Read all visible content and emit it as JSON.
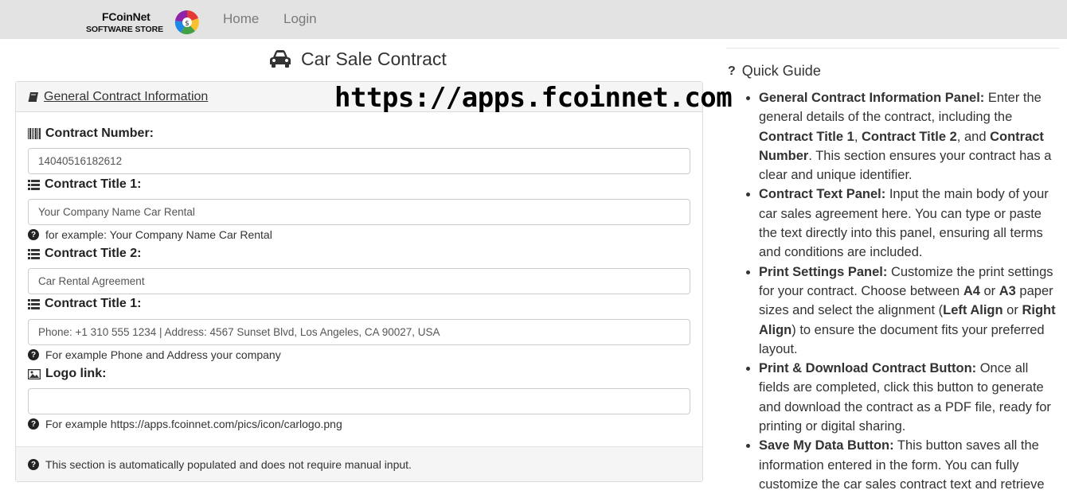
{
  "nav": {
    "brand_line1": "FCoinNet",
    "brand_line2": "SOFTWARE STORE",
    "links": [
      "Home",
      "Login"
    ]
  },
  "page": {
    "title": "Car Sale Contract"
  },
  "card": {
    "header_title": "General Contract Information",
    "watermark": "https://apps.fcoinnet.com",
    "fields": {
      "contract_number": {
        "label": "Contract Number:",
        "value": "14040516182612"
      },
      "title1": {
        "label": "Contract Title 1:",
        "value": "Your Company Name Car Rental",
        "help": "for example: Your Company Name Car Rental"
      },
      "title2": {
        "label": "Contract Title 2:",
        "value": "Car Rental Agreement"
      },
      "title3": {
        "label": "Contract Title 1:",
        "value": "Phone: +1 310 555 1234 | Address: 4567 Sunset Blvd, Los Angeles, CA 90027, USA",
        "help": "For example Phone and Address your company"
      },
      "logo": {
        "label": "Logo link:",
        "value": "",
        "help": "For example https://apps.fcoinnet.com/pics/icon/carlogo.png"
      }
    },
    "footer_note": "This section is automatically populated and does not require manual input."
  },
  "guide": {
    "title": "Quick Guide",
    "items": [
      {
        "segments": [
          {
            "b": true,
            "t": "General Contract Information Panel:"
          },
          {
            "b": false,
            "t": " Enter the general details of the contract, including the "
          },
          {
            "b": true,
            "t": "Contract Title 1"
          },
          {
            "b": false,
            "t": ", "
          },
          {
            "b": true,
            "t": "Contract Title 2"
          },
          {
            "b": false,
            "t": ", and "
          },
          {
            "b": true,
            "t": "Contract Number"
          },
          {
            "b": false,
            "t": ". This section ensures your contract has a clear and unique identifier."
          }
        ]
      },
      {
        "segments": [
          {
            "b": true,
            "t": "Contract Text Panel:"
          },
          {
            "b": false,
            "t": " Input the main body of your car sales agreement here. You can type or paste the text directly into this panel, ensuring all terms and conditions are included."
          }
        ]
      },
      {
        "segments": [
          {
            "b": true,
            "t": "Print Settings Panel:"
          },
          {
            "b": false,
            "t": " Customize the print settings for your contract. Choose between "
          },
          {
            "b": true,
            "t": "A4"
          },
          {
            "b": false,
            "t": " or "
          },
          {
            "b": true,
            "t": "A3"
          },
          {
            "b": false,
            "t": " paper sizes and select the alignment ("
          },
          {
            "b": true,
            "t": "Left Align"
          },
          {
            "b": false,
            "t": " or "
          },
          {
            "b": true,
            "t": "Right Align"
          },
          {
            "b": false,
            "t": ") to ensure the document fits your preferred layout."
          }
        ]
      },
      {
        "segments": [
          {
            "b": true,
            "t": "Print & Download Contract Button:"
          },
          {
            "b": false,
            "t": " Once all fields are completed, click this button to generate and download the contract as a PDF file, ready for printing or digital sharing."
          }
        ]
      },
      {
        "segments": [
          {
            "b": true,
            "t": "Save My Data Button:"
          },
          {
            "b": false,
            "t": " This button saves all the information entered in the form. You can fully customize the car sales contract text and retrieve"
          }
        ]
      }
    ]
  }
}
